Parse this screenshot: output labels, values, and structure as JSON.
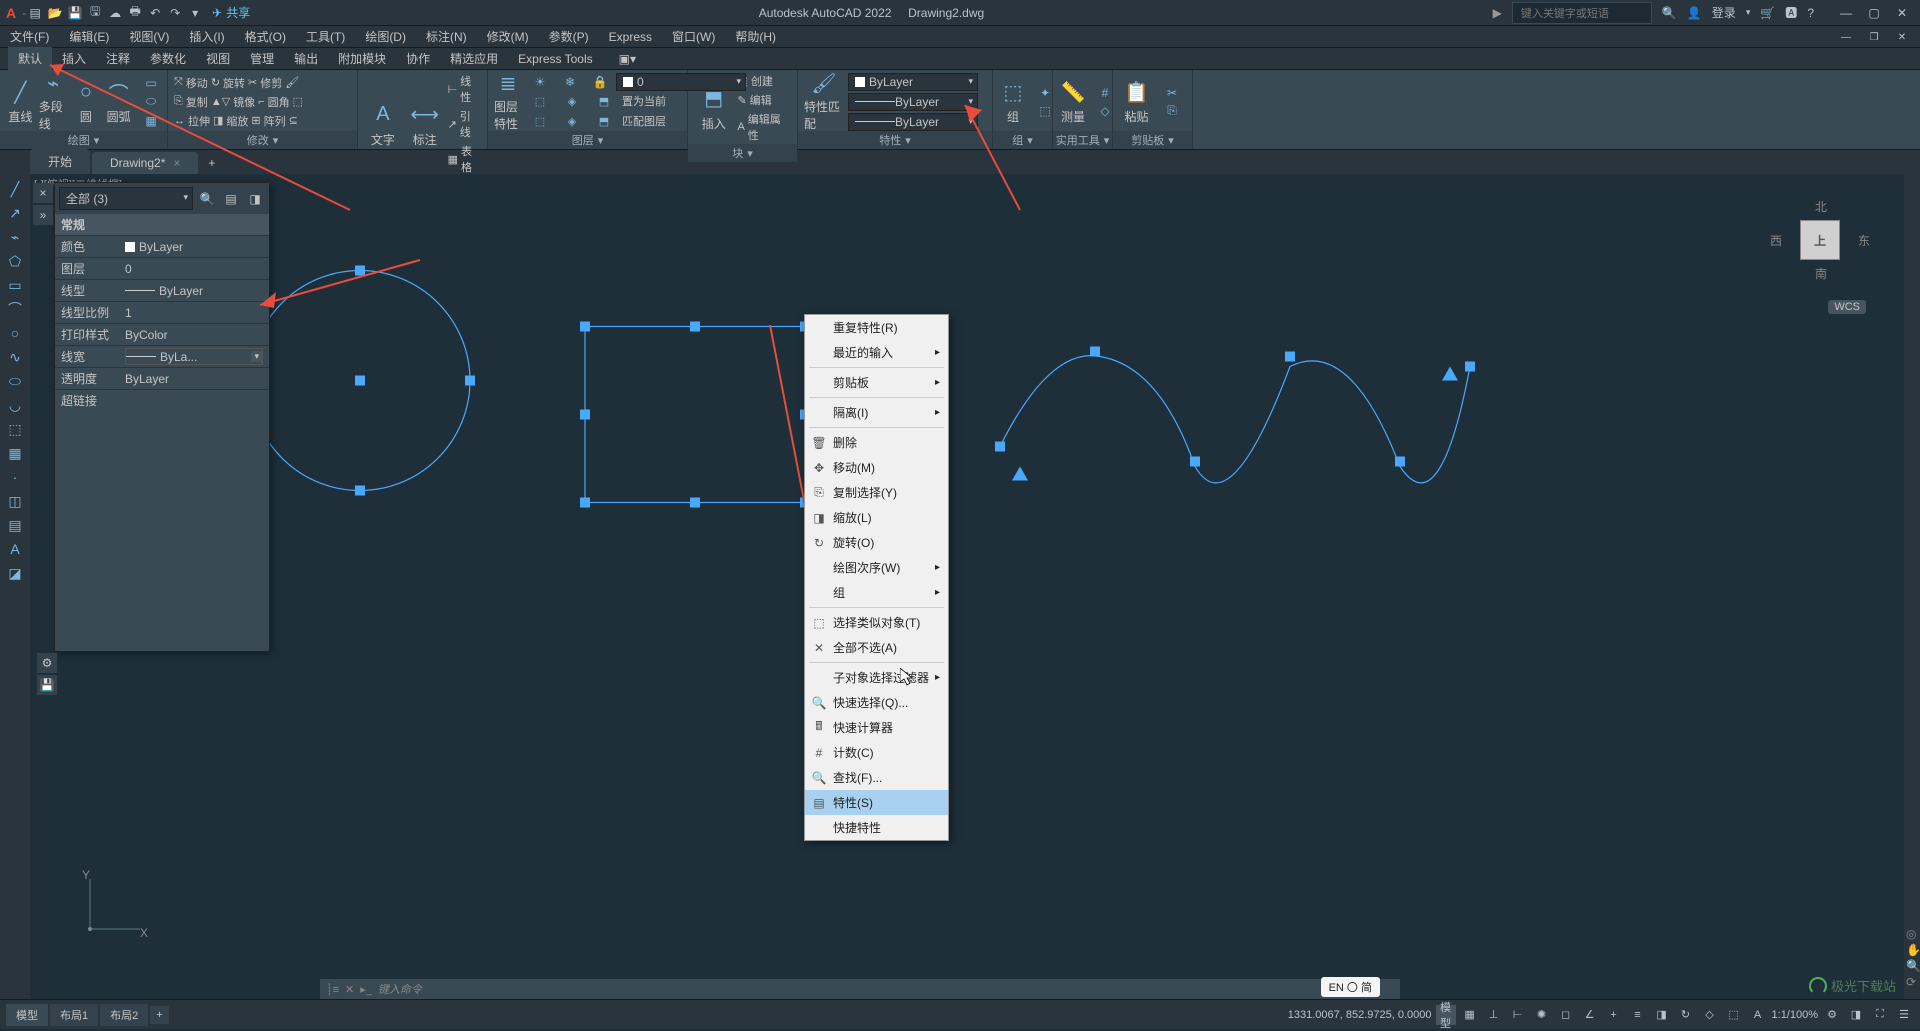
{
  "title_bar": {
    "app_name": "Autodesk AutoCAD 2022",
    "doc_name": "Drawing2.dwg",
    "share": "共享",
    "search_placeholder": "键入关键字或短语",
    "login": "登录"
  },
  "menus": [
    "文件(F)",
    "编辑(E)",
    "视图(V)",
    "插入(I)",
    "格式(O)",
    "工具(T)",
    "绘图(D)",
    "标注(N)",
    "修改(M)",
    "参数(P)",
    "Express",
    "窗口(W)",
    "帮助(H)"
  ],
  "ribbon_tabs": [
    "默认",
    "插入",
    "注释",
    "参数化",
    "视图",
    "管理",
    "输出",
    "附加模块",
    "协作",
    "精选应用",
    "Express Tools"
  ],
  "ribbon": {
    "draw": {
      "label": "绘图",
      "line": "直线",
      "polyline": "多段线",
      "circle": "圆",
      "arc": "圆弧"
    },
    "modify": {
      "label": "修改",
      "move": "移动",
      "rotate": "旋转",
      "trim": "修剪",
      "copy": "复制",
      "mirror": "镜像",
      "fillet": "圆角",
      "stretch": "拉伸",
      "scale": "缩放",
      "array": "阵列"
    },
    "annotate": {
      "label": "注释",
      "text": "文字",
      "dim": "标注",
      "linear": "线性",
      "leader": "引线",
      "table": "表格"
    },
    "layers": {
      "label": "图层",
      "layer_prop": "图层特性",
      "set_current": "置为当前",
      "match": "匹配图层",
      "layer_name": "0"
    },
    "block": {
      "label": "块",
      "insert": "插入",
      "create": "创建",
      "edit": "编辑",
      "attr": "编辑属性"
    },
    "properties": {
      "label": "特性",
      "match": "特性匹配",
      "color": "ByLayer",
      "linetype": "ByLayer",
      "lineweight": "ByLayer"
    },
    "group": {
      "label": "组",
      "group": "组"
    },
    "utilities": {
      "label": "实用工具",
      "measure": "测量"
    },
    "clipboard": {
      "label": "剪贴板",
      "paste": "粘贴"
    }
  },
  "file_tabs": {
    "start": "开始",
    "drawing": "Drawing2*"
  },
  "viewport_label": "[-][俯视][二维线框]",
  "nav_cube": {
    "top": "上",
    "n": "北",
    "e": "东",
    "s": "南",
    "w": "西"
  },
  "wcs": "WCS",
  "prop_palette": {
    "selection": "全部 (3)",
    "section": "常规",
    "color_lbl": "颜色",
    "color_val": "ByLayer",
    "layer_lbl": "图层",
    "layer_val": "0",
    "linetype_lbl": "线型",
    "linetype_val": "ByLayer",
    "ltscale_lbl": "线型比例",
    "ltscale_val": "1",
    "plotstyle_lbl": "打印样式",
    "plotstyle_val": "ByColor",
    "lineweight_lbl": "线宽",
    "lineweight_val": "ByLa...",
    "trans_lbl": "透明度",
    "trans_val": "ByLayer",
    "hyperlink_lbl": "超链接"
  },
  "context_menu": {
    "repeat": "重复特性(R)",
    "recent": "最近的输入",
    "clipboard": "剪贴板",
    "isolate": "隔离(I)",
    "erase": "删除",
    "move": "移动(M)",
    "copysel": "复制选择(Y)",
    "scale": "缩放(L)",
    "rotate": "旋转(O)",
    "draworder": "绘图次序(W)",
    "group": "组",
    "selsimilar": "选择类似对象(T)",
    "deselect": "全部不选(A)",
    "subfilter": "子对象选择过滤器",
    "qselect": "快速选择(Q)...",
    "qcalc": "快速计算器",
    "count": "计数(C)",
    "find": "查找(F)...",
    "properties": "特性(S)",
    "qprops": "快捷特性"
  },
  "status": {
    "model": "模型",
    "layout1": "布局1",
    "layout2": "布局2",
    "coords": "1331.0067, 852.9725, 0.0000",
    "model_btn": "模型",
    "scale": "1:1/100%",
    "lang": "EN 〇 简"
  },
  "cmd_prompt": "键入命令",
  "watermark": "极光下载站"
}
